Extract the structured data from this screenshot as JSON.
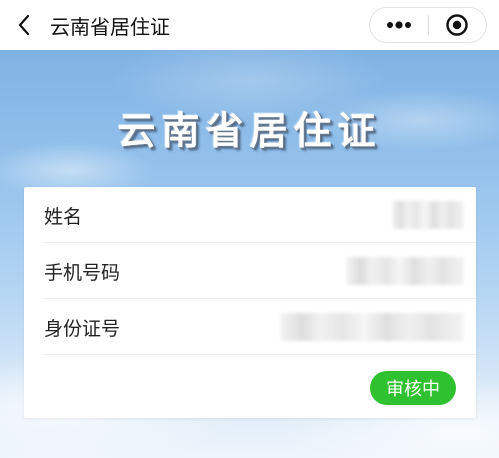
{
  "navbar": {
    "title": "云南省居住证",
    "back_icon": "chevron-left-icon",
    "more_icon": "more-dots-icon",
    "close_icon": "target-circle-icon"
  },
  "banner": {
    "title": "云南省居住证"
  },
  "info": {
    "rows": [
      {
        "label": "姓名"
      },
      {
        "label": "手机号码"
      },
      {
        "label": "身份证号"
      }
    ],
    "status": "审核中"
  },
  "colors": {
    "status_badge": "#2fc12f",
    "sky_top": "#7fb2e3",
    "sky_bottom": "#eef5fc"
  }
}
